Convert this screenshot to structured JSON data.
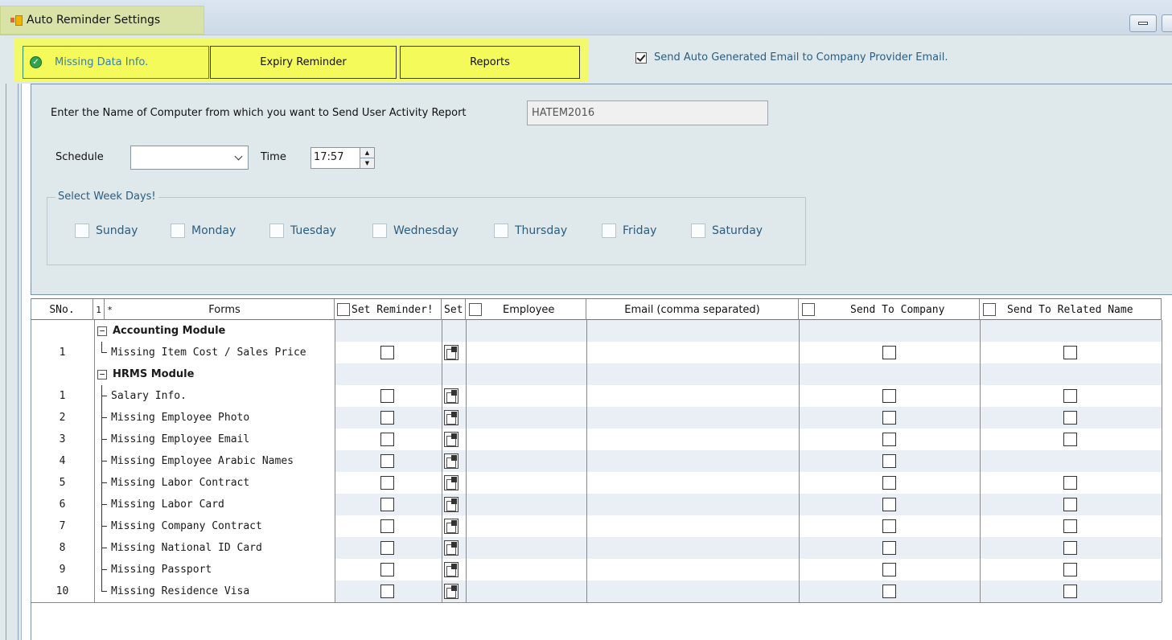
{
  "window": {
    "title": "Auto Reminder Settings"
  },
  "tabs": [
    {
      "label": "Missing Data Info.",
      "active": true
    },
    {
      "label": "Expiry Reminder",
      "active": false
    },
    {
      "label": "Reports",
      "active": false
    }
  ],
  "auto_email": {
    "label": "Send Auto Generated Email to Company Provider Email.",
    "checked": true
  },
  "settings": {
    "computer_label": "Enter the Name of Computer from which you want to  Send User Activity Report",
    "computer_value": "HATEM2016",
    "schedule_label": "Schedule",
    "schedule_value": "",
    "time_label": "Time",
    "time_value": "17:57",
    "weekdays_legend": "Select Week Days!",
    "weekdays": [
      "Sunday",
      "Monday",
      "Tuesday",
      "Wednesday",
      "Thursday",
      "Friday",
      "Saturday"
    ]
  },
  "grid": {
    "headers": {
      "sno": "SNo.",
      "level": "1",
      "star": "*",
      "forms": "Forms",
      "set_reminder": "Set Reminder!",
      "set": "Set",
      "employee": "Employee",
      "email": "Email (comma separated)",
      "send_company": "Send To Company",
      "send_related": "Send To Related Name"
    },
    "groups": [
      {
        "name": "Accounting Module",
        "rows": [
          {
            "sno": "1",
            "form": "Missing Item Cost / Sales Price",
            "related": true
          }
        ]
      },
      {
        "name": "HRMS Module",
        "rows": [
          {
            "sno": "1",
            "form": "Salary Info.",
            "related": true
          },
          {
            "sno": "2",
            "form": "Missing Employee Photo",
            "related": true
          },
          {
            "sno": "3",
            "form": "Missing Employee Email",
            "related": true
          },
          {
            "sno": "4",
            "form": "Missing Employee Arabic Names",
            "related": false
          },
          {
            "sno": "5",
            "form": "Missing Labor Contract",
            "related": true
          },
          {
            "sno": "6",
            "form": "Missing Labor Card",
            "related": true
          },
          {
            "sno": "7",
            "form": "Missing Company Contract",
            "related": true
          },
          {
            "sno": "8",
            "form": "Missing National ID Card",
            "related": true
          },
          {
            "sno": "9",
            "form": "Missing Passport",
            "related": true
          },
          {
            "sno": "10",
            "form": "Missing Residence Visa",
            "related": true
          }
        ]
      }
    ]
  }
}
